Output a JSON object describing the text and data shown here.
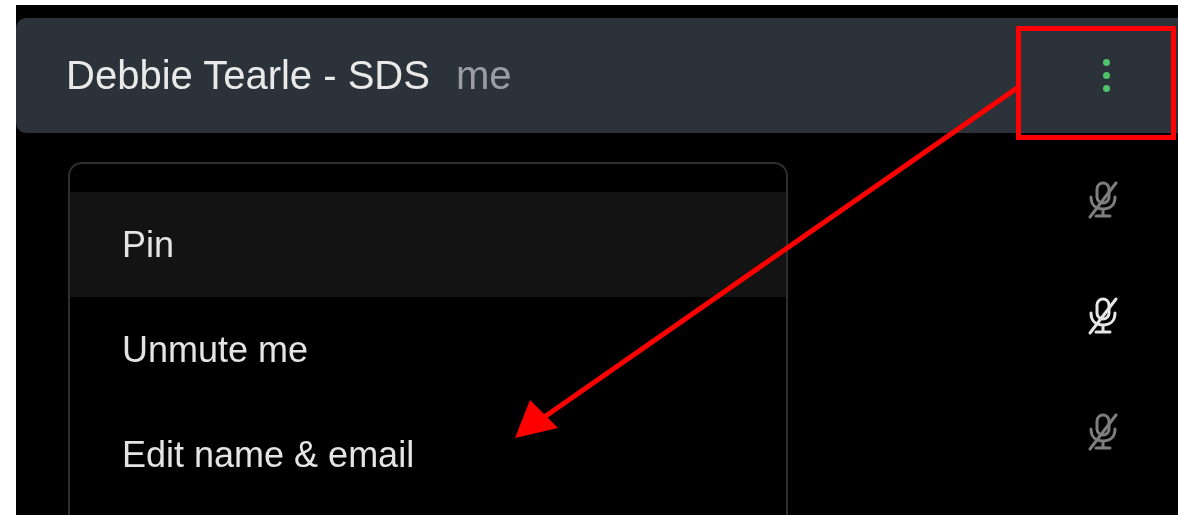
{
  "participant": {
    "name": "Debbie Tearle - SDS",
    "tag": "me"
  },
  "menu": {
    "items": [
      {
        "label": "Pin",
        "selected": true
      },
      {
        "label": "Unmute me",
        "selected": false
      },
      {
        "label": "Edit name & email",
        "selected": false
      }
    ]
  },
  "mute_icons": [
    {
      "highlighted": false
    },
    {
      "highlighted": true
    },
    {
      "highlighted": false
    }
  ]
}
